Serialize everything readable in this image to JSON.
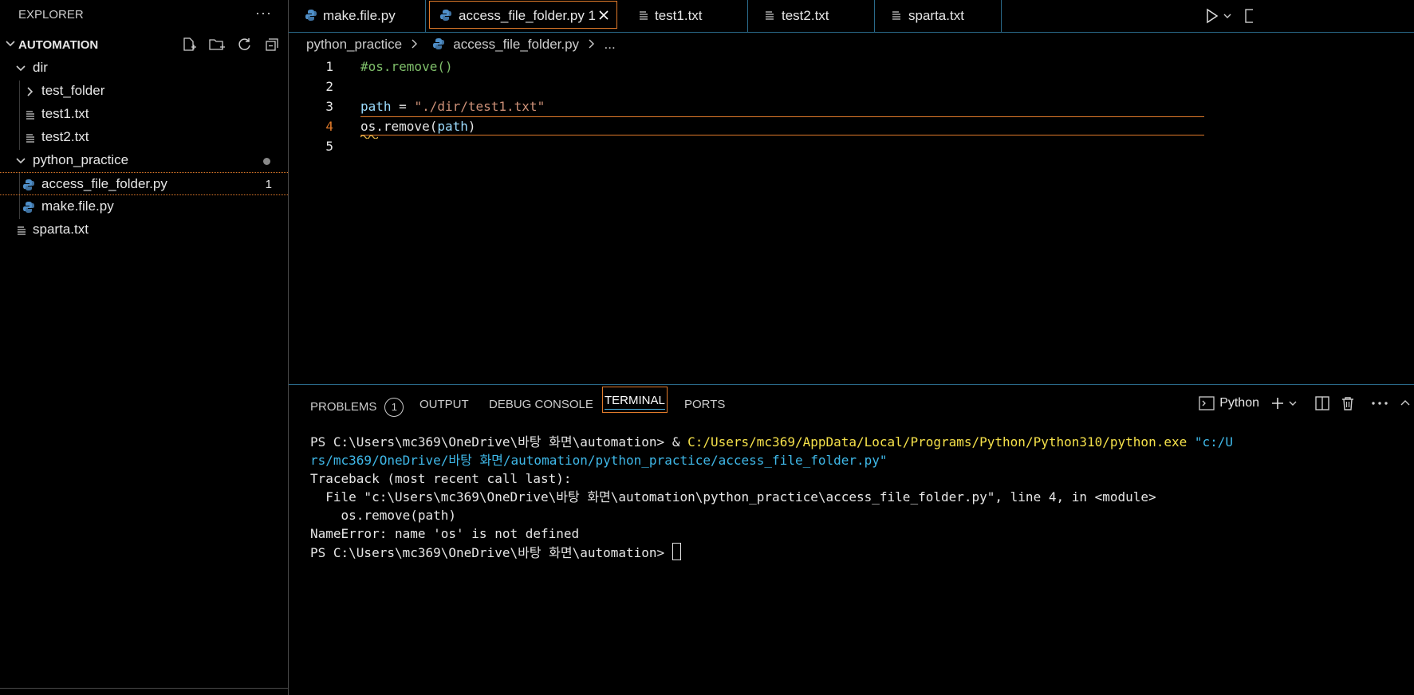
{
  "explorer": {
    "title": "EXPLORER",
    "more": "···",
    "root_label": "AUTOMATION",
    "tree": [
      {
        "label": "dir"
      },
      {
        "label": "test_folder"
      },
      {
        "label": "test1.txt"
      },
      {
        "label": "test2.txt"
      },
      {
        "label": "python_practice"
      },
      {
        "label": "access_file_folder.py",
        "badge": "1"
      },
      {
        "label": "make.file.py"
      },
      {
        "label": "sparta.txt"
      }
    ]
  },
  "tabs": [
    {
      "label": "make.file.py"
    },
    {
      "label": "access_file_folder.py 1"
    },
    {
      "label": "test1.txt"
    },
    {
      "label": "test2.txt"
    },
    {
      "label": "sparta.txt"
    }
  ],
  "breadcrumb": {
    "folder": "python_practice",
    "file": "access_file_folder.py",
    "symbol": "..."
  },
  "editor": {
    "line_numbers": [
      "1",
      "2",
      "3",
      "4",
      "5"
    ],
    "line1": "#os.remove()",
    "line3_var": "path",
    "line3_eq": " = ",
    "line3_str": "\"./dir/test1.txt\"",
    "line4_a": "os.remove(",
    "line4_var": "path",
    "line4_b": ")"
  },
  "panel": {
    "tabs": [
      "PROBLEMS",
      "OUTPUT",
      "DEBUG CONSOLE",
      "TERMINAL",
      "PORTS"
    ],
    "problems_count": "1",
    "terminal_profile": "Python"
  },
  "terminal": {
    "l1_prompt": "PS C:\\Users\\mc369\\OneDrive\\바탕 화면\\automation> & ",
    "l1_exe": "C:/Users/mc369/AppData/Local/Programs/Python/Python310/python.exe",
    "l1_arg": " \"c:/U",
    "l2": "rs/mc369/OneDrive/바탕 화면/automation/python_practice/access_file_folder.py\"",
    "l3": "Traceback (most recent call last):",
    "l4": "  File \"c:\\Users\\mc369\\OneDrive\\바탕 화면\\automation\\python_practice\\access_file_folder.py\", line 4, in <module>",
    "l5": "    os.remove(path)",
    "l6": "NameError: name 'os' is not defined",
    "l7": "PS C:\\Users\\mc369\\OneDrive\\바탕 화면\\automation> "
  }
}
